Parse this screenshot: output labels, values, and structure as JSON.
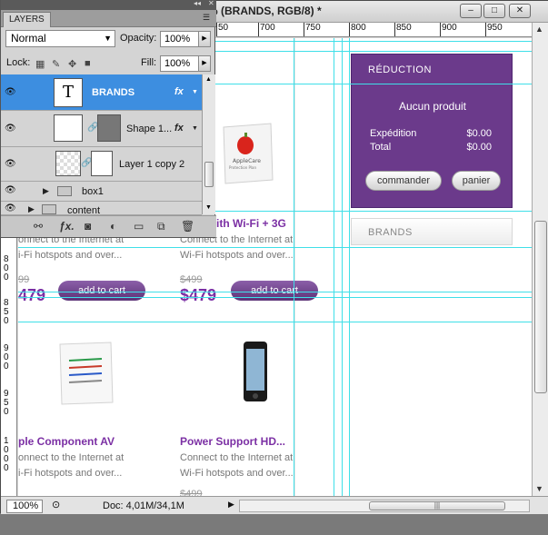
{
  "document": {
    "title": "% (BRANDS, RGB/8) *",
    "window_buttons": [
      "–",
      "□",
      "✕"
    ],
    "ruler_top": [
      "50",
      "700",
      "750",
      "800",
      "850",
      "900",
      "950"
    ],
    "ruler_left": [
      "8",
      "0",
      "0",
      "8",
      "5",
      "0",
      "9",
      "0",
      "0",
      "9",
      "5",
      "0",
      "1",
      "0",
      "0",
      "0"
    ],
    "status": {
      "zoom": "100%",
      "doc_info": "Doc: 4,01M/34,1M"
    }
  },
  "canvas": {
    "cart": {
      "title": "RÉDUCTION",
      "empty": "Aucun produit",
      "shipping_label": "Expédition",
      "shipping_value": "$0.00",
      "total_label": "Total",
      "total_value": "$0.00",
      "order_button": "commander",
      "cart_button": "panier"
    },
    "brands_label": "BRANDS",
    "products_row1": [
      {
        "title": "",
        "desc1": "onnect to the Internet at",
        "desc2": "i-Fi hotspots and over...",
        "old_price": "99",
        "price": "479",
        "button": "add to cart"
      },
      {
        "title": "ith Wi-Fi + 3G",
        "desc1": "Connect to the Internet at",
        "desc2": "Wi-Fi hotspots and over...",
        "old_price": "$499",
        "price": "$479",
        "button": "add to cart"
      }
    ],
    "products_row2": [
      {
        "title": "ple Component AV",
        "desc1": "onnect to the Internet at",
        "desc2": "i-Fi hotspots and over..."
      },
      {
        "title": "Power Support HD...",
        "desc1": "Connect to the Internet at",
        "desc2": "Wi-Fi hotspots and over...",
        "old_price": "$499"
      }
    ],
    "applecare_text": "AppleCare",
    "applecare_sub": "Protection Plan"
  },
  "layers_panel": {
    "tab": "LAYERS",
    "blend_mode": "Normal",
    "opacity_label": "Opacity:",
    "opacity_value": "100%",
    "lock_label": "Lock:",
    "fill_label": "Fill:",
    "fill_value": "100%",
    "layers": [
      {
        "name": "BRANDS",
        "selected": true,
        "fx": "fx",
        "thumb": "T"
      },
      {
        "name": "Shape 1...",
        "fx": "fx"
      },
      {
        "name": "Layer 1 copy 2"
      },
      {
        "name": "box1"
      },
      {
        "name": "content"
      }
    ]
  },
  "colors": {
    "accent": "#7b2fa4",
    "cart_bg": "#6b3a8b",
    "guide": "#3fdfe8",
    "layer_selected": "#3d8ee0"
  }
}
